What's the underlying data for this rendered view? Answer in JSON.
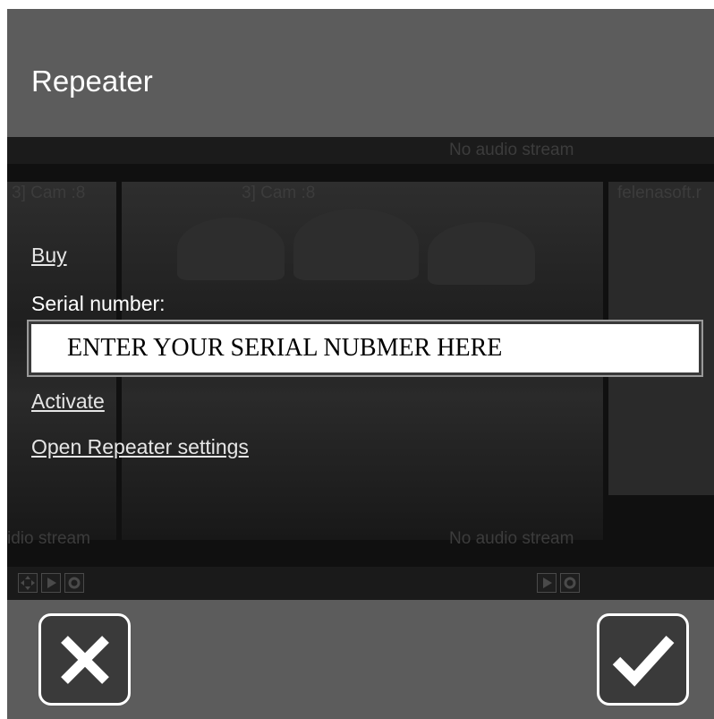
{
  "dialog": {
    "title": "Repeater",
    "buy_link": "Buy",
    "serial_label": "Serial number:",
    "serial_placeholder": "ENTER YOUR SERIAL NUBMER HERE",
    "activate_link": "Activate",
    "settings_link": "Open Repeater settings"
  },
  "background": {
    "cam_labels": [
      "3] Cam :8",
      "3] Cam :8",
      "felenasoft.r"
    ],
    "audio_top": "No audio stream",
    "audio_left": "idio stream",
    "audio_right": "No audio stream"
  },
  "buttons": {
    "cancel_icon": "close-icon",
    "confirm_icon": "checkmark-icon"
  },
  "colors": {
    "bar": "#5c5c5c",
    "background": "#151515",
    "button_border": "#ffffff"
  }
}
